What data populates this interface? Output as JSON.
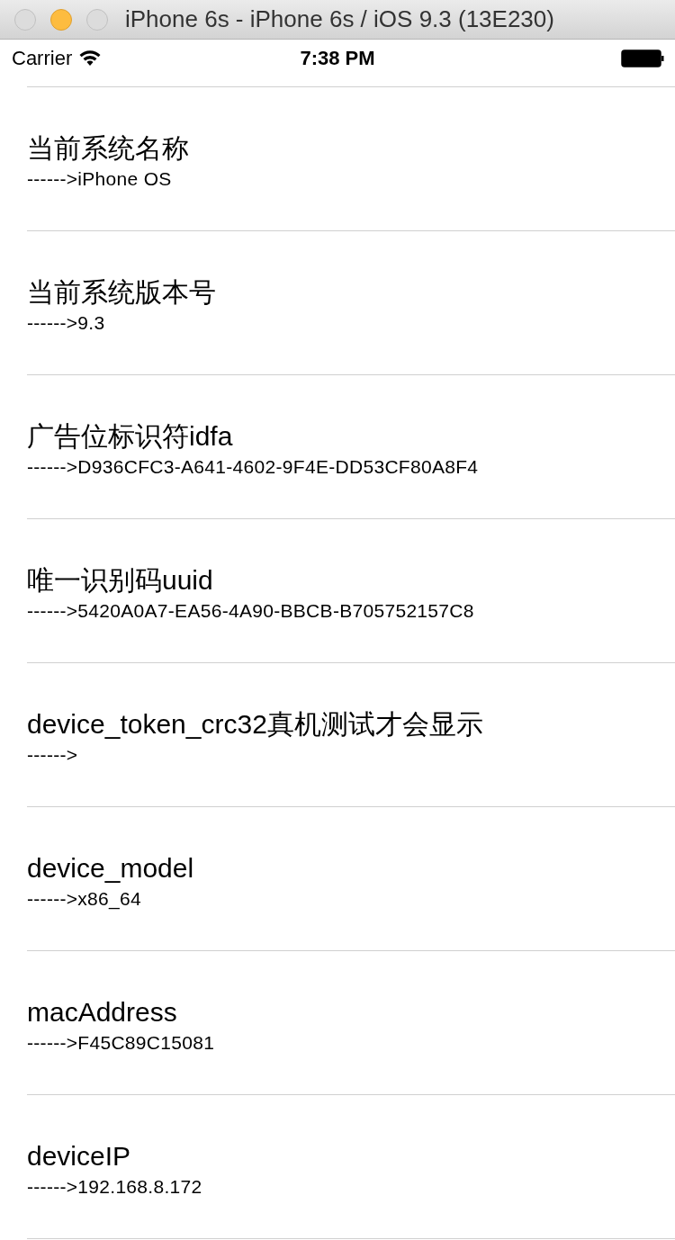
{
  "window": {
    "title": "iPhone 6s - iPhone 6s / iOS 9.3 (13E230)"
  },
  "status_bar": {
    "carrier": "Carrier",
    "time": "7:38 PM"
  },
  "rows": [
    {
      "title": "当前系统名称",
      "value": "------>iPhone OS"
    },
    {
      "title": "当前系统版本号",
      "value": "------>9.3"
    },
    {
      "title": "广告位标识符idfa",
      "value": "------>D936CFC3-A641-4602-9F4E-DD53CF80A8F4"
    },
    {
      "title": "唯一识别码uuid",
      "value": "------>5420A0A7-EA56-4A90-BBCB-B705752157C8"
    },
    {
      "title": "device_token_crc32真机测试才会显示",
      "value": "------>"
    },
    {
      "title": "device_model",
      "value": "------>x86_64"
    },
    {
      "title": "macAddress",
      "value": "------>F45C89C15081"
    },
    {
      "title": "deviceIP",
      "value": "------>192.168.8.172"
    }
  ]
}
